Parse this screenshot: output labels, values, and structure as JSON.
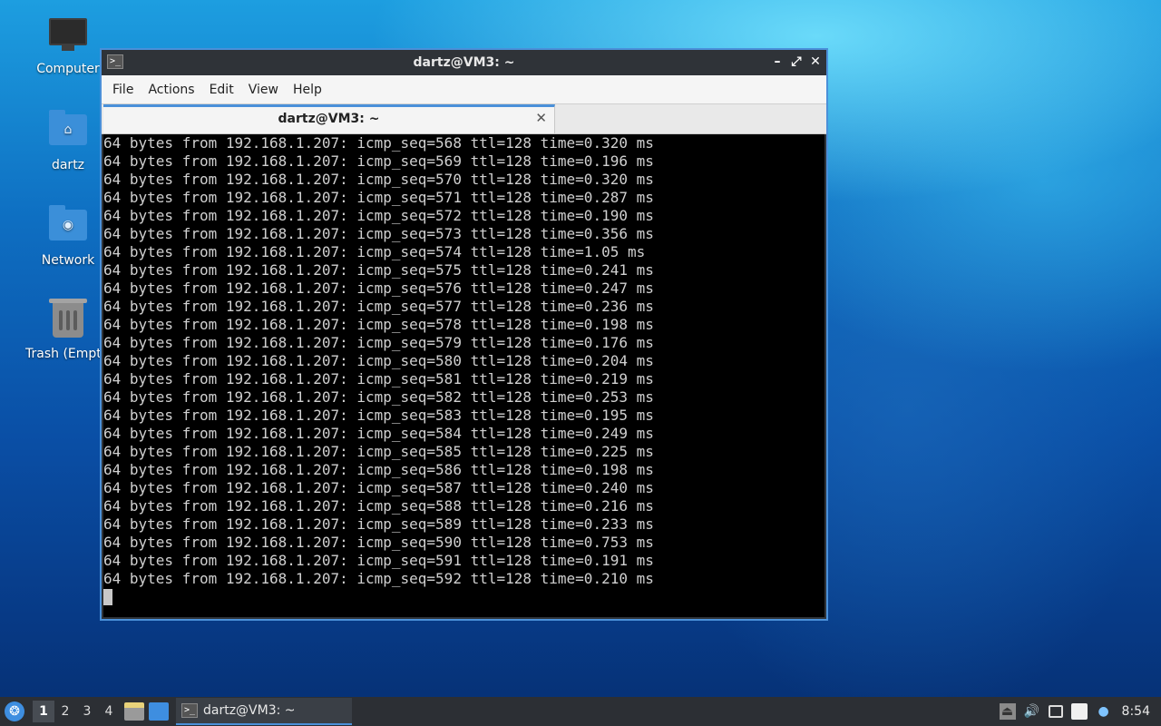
{
  "desktop": {
    "icons": [
      {
        "label": "Computer",
        "icon": "computer-icon"
      },
      {
        "label": "dartz",
        "icon": "home-folder-icon"
      },
      {
        "label": "Network",
        "icon": "network-folder-icon"
      },
      {
        "label": "Trash (Empt",
        "icon": "trash-icon"
      }
    ]
  },
  "window": {
    "title": "dartz@VM3: ~",
    "controls": {
      "minimize": "–",
      "maximize": "⤢",
      "close": "✕"
    },
    "menu": [
      "File",
      "Actions",
      "Edit",
      "View",
      "Help"
    ],
    "tab": {
      "label": "dartz@VM3: ~",
      "close": "✕"
    }
  },
  "terminal": {
    "lines": [
      "64 bytes from 192.168.1.207: icmp_seq=568 ttl=128 time=0.320 ms",
      "64 bytes from 192.168.1.207: icmp_seq=569 ttl=128 time=0.196 ms",
      "64 bytes from 192.168.1.207: icmp_seq=570 ttl=128 time=0.320 ms",
      "64 bytes from 192.168.1.207: icmp_seq=571 ttl=128 time=0.287 ms",
      "64 bytes from 192.168.1.207: icmp_seq=572 ttl=128 time=0.190 ms",
      "64 bytes from 192.168.1.207: icmp_seq=573 ttl=128 time=0.356 ms",
      "64 bytes from 192.168.1.207: icmp_seq=574 ttl=128 time=1.05 ms",
      "64 bytes from 192.168.1.207: icmp_seq=575 ttl=128 time=0.241 ms",
      "64 bytes from 192.168.1.207: icmp_seq=576 ttl=128 time=0.247 ms",
      "64 bytes from 192.168.1.207: icmp_seq=577 ttl=128 time=0.236 ms",
      "64 bytes from 192.168.1.207: icmp_seq=578 ttl=128 time=0.198 ms",
      "64 bytes from 192.168.1.207: icmp_seq=579 ttl=128 time=0.176 ms",
      "64 bytes from 192.168.1.207: icmp_seq=580 ttl=128 time=0.204 ms",
      "64 bytes from 192.168.1.207: icmp_seq=581 ttl=128 time=0.219 ms",
      "64 bytes from 192.168.1.207: icmp_seq=582 ttl=128 time=0.253 ms",
      "64 bytes from 192.168.1.207: icmp_seq=583 ttl=128 time=0.195 ms",
      "64 bytes from 192.168.1.207: icmp_seq=584 ttl=128 time=0.249 ms",
      "64 bytes from 192.168.1.207: icmp_seq=585 ttl=128 time=0.225 ms",
      "64 bytes from 192.168.1.207: icmp_seq=586 ttl=128 time=0.198 ms",
      "64 bytes from 192.168.1.207: icmp_seq=587 ttl=128 time=0.240 ms",
      "64 bytes from 192.168.1.207: icmp_seq=588 ttl=128 time=0.216 ms",
      "64 bytes from 192.168.1.207: icmp_seq=589 ttl=128 time=0.233 ms",
      "64 bytes from 192.168.1.207: icmp_seq=590 ttl=128 time=0.753 ms",
      "64 bytes from 192.168.1.207: icmp_seq=591 ttl=128 time=0.191 ms",
      "64 bytes from 192.168.1.207: icmp_seq=592 ttl=128 time=0.210 ms"
    ]
  },
  "taskbar": {
    "workspaces": [
      "1",
      "2",
      "3",
      "4"
    ],
    "active_workspace": "1",
    "task_label": "dartz@VM3: ~",
    "clock": "8:54"
  },
  "colors": {
    "accent": "#4a90d9",
    "terminal_bg": "#000000",
    "terminal_fg": "#d0d0d0",
    "titlebar_bg": "#2f3338",
    "taskbar_bg": "#2c2f34"
  }
}
